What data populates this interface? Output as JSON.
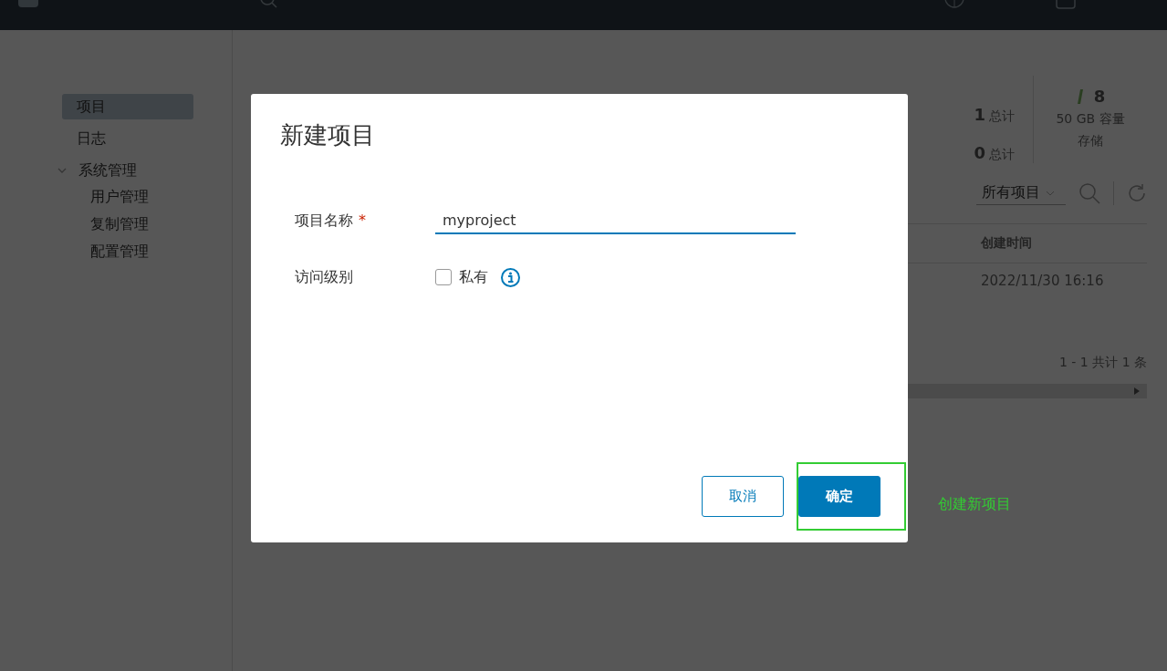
{
  "sidebar": {
    "items": [
      {
        "label": "项目",
        "selected": true
      },
      {
        "label": "日志",
        "selected": false
      },
      {
        "label": "系统管理",
        "selected": false,
        "expanded": true,
        "children": [
          {
            "label": "用户管理",
            "selected": false
          },
          {
            "label": "复制管理",
            "selected": false
          },
          {
            "label": "配置管理",
            "selected": false
          }
        ]
      }
    ]
  },
  "page": {
    "stats": [
      {
        "count": "1",
        "count_label": "总计"
      },
      {
        "count": "0",
        "count_label": "总计"
      }
    ],
    "storage": {
      "count": "8",
      "capacity": "50 GB 容量",
      "label": "存储"
    },
    "filter": "所有项目",
    "table": {
      "columns": [
        "创建时间"
      ],
      "rows": [
        [
          "2022/11/30 16:16"
        ]
      ],
      "pagination": "1 - 1 共计 1 条"
    }
  },
  "dialog": {
    "title": "新建项目",
    "fields": [
      {
        "kind": "text",
        "label": "项目名称",
        "required_mark": "*",
        "value": "myproject"
      },
      {
        "kind": "checkbox",
        "label": "访问级别",
        "option": "私有",
        "checked": false
      }
    ],
    "buttons": [
      {
        "label": "取消",
        "kind": "secondary"
      },
      {
        "label": "确定",
        "kind": "primary"
      }
    ]
  },
  "annotation": {
    "text": "创建新项目"
  }
}
